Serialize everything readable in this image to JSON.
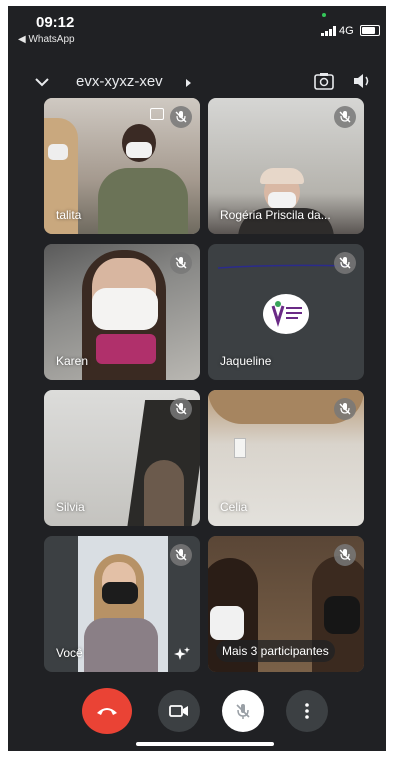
{
  "status_bar": {
    "time": "09:12",
    "back_app": "◀ WhatsApp",
    "network": "4G"
  },
  "meeting": {
    "code": "evx-xyxz-xev"
  },
  "tiles": [
    {
      "name": "talita",
      "muted": true
    },
    {
      "name": "Rogéria Priscila da...",
      "muted": true
    },
    {
      "name": "Karen",
      "muted": true
    },
    {
      "name": "Jaqueline",
      "muted": true
    },
    {
      "name": "Silvia",
      "muted": true
    },
    {
      "name": "Celia",
      "muted": true
    },
    {
      "name": "Você",
      "muted": true
    },
    {
      "name": "Mais 3 participantes"
    }
  ],
  "icons": {
    "chevron": "chevron-down-icon",
    "camera_switch": "camera-switch-icon",
    "speaker": "speaker-icon",
    "mic_off": "mic-off-icon",
    "hangup": "hangup-icon",
    "camera": "camera-icon",
    "more": "more-vert-icon",
    "effects": "sparkle-icon"
  },
  "colors": {
    "background": "#202124",
    "hangup": "#ea4335",
    "tile": "#3c4043"
  }
}
